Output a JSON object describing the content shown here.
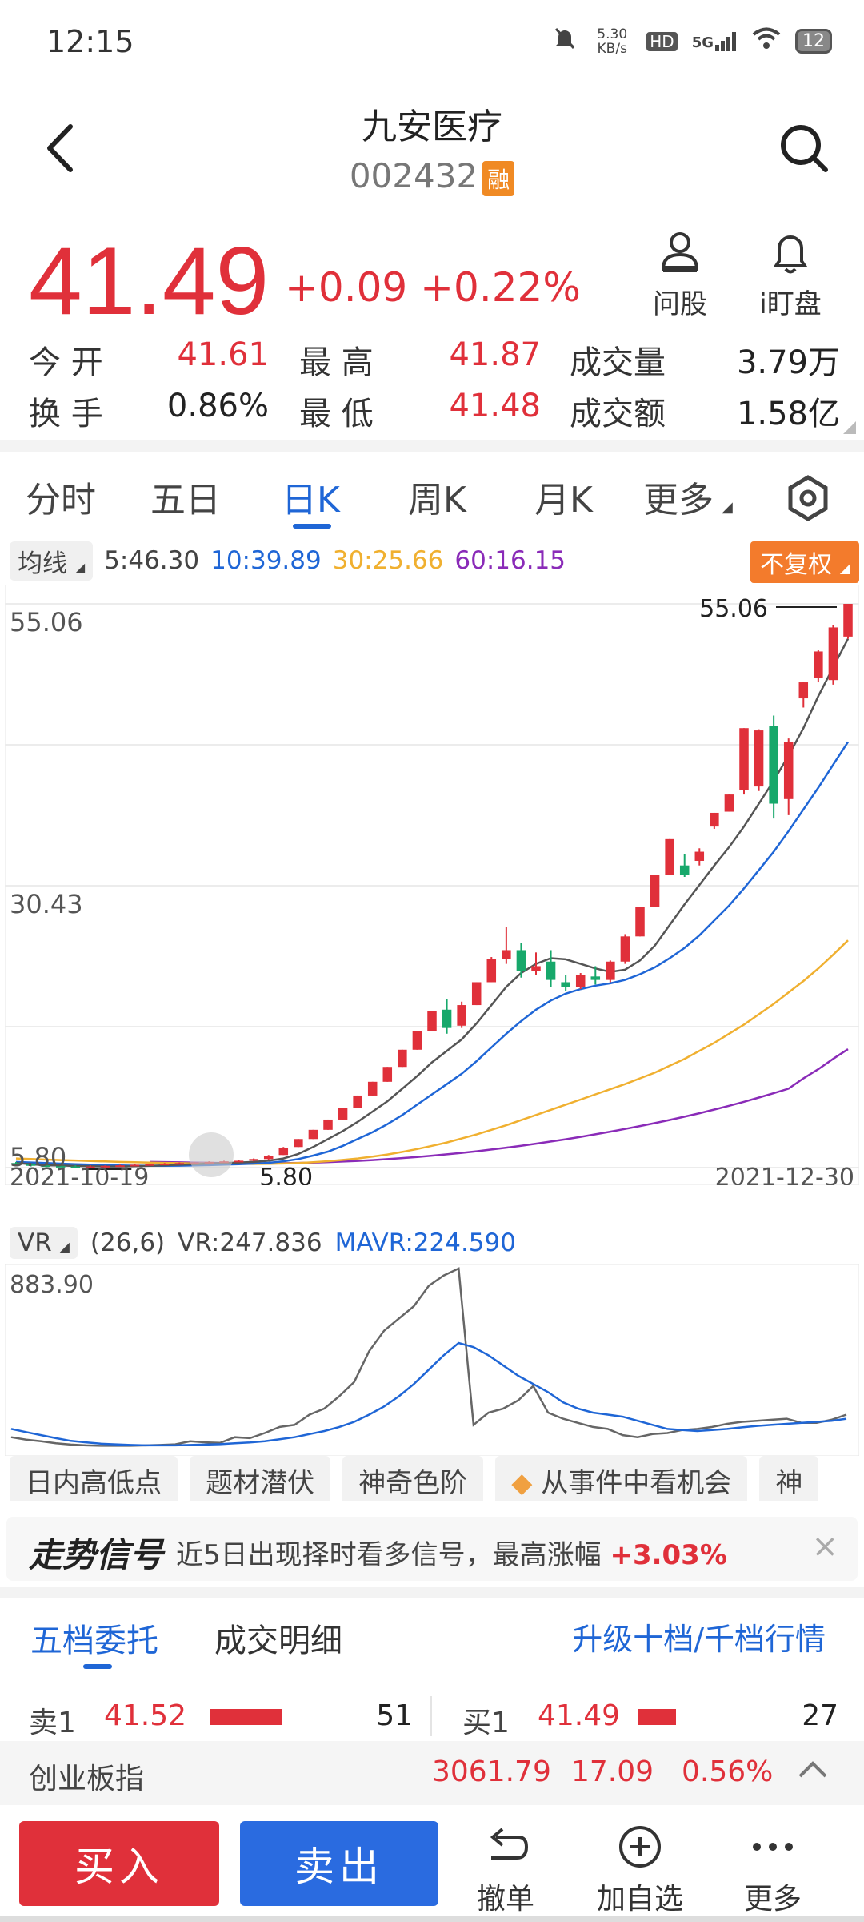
{
  "status": {
    "time": "12:15",
    "net_speed": "5.30 KB/s",
    "hd": "HD",
    "network": "5G",
    "battery": "12"
  },
  "header": {
    "title": "九安医疗",
    "code": "002432",
    "margin_badge": "融"
  },
  "quote": {
    "price": "41.49",
    "change": "+0.09",
    "change_pct": "+0.22%",
    "ask_label": "问股",
    "watch_label": "i盯盘"
  },
  "stats": {
    "open_label": "今 开",
    "open": "41.61",
    "high_label": "最 高",
    "high": "41.87",
    "volume_label": "成交量",
    "volume": "3.79万",
    "turnover_label": "换 手",
    "turnover": "0.86%",
    "low_label": "最 低",
    "low": "41.48",
    "amount_label": "成交额",
    "amount": "1.58亿"
  },
  "tabs": [
    {
      "label": "分时"
    },
    {
      "label": "五日"
    },
    {
      "label": "日K"
    },
    {
      "label": "周K"
    },
    {
      "label": "月K"
    },
    {
      "label": "更多"
    }
  ],
  "ma": {
    "label": "均线",
    "ma5": "5:46.30",
    "ma10": "10:39.89",
    "ma30": "30:25.66",
    "ma60": "60:16.15",
    "adjust": "不复权"
  },
  "colors": {
    "up": "#e0303a",
    "down": "#17a86b",
    "ma5": "#555555",
    "ma10": "#1f66d6",
    "ma30": "#f0b030",
    "ma60": "#8a2bb8"
  },
  "chart_data": [
    {
      "type": "candlestick",
      "title": "",
      "x_start": "2021-10-19",
      "x_end": "2021-12-30",
      "ylim": [
        5.8,
        55.06
      ],
      "y_ticks": [
        "55.06",
        "30.43",
        "5.80"
      ],
      "max_label": "55.06",
      "min_label": "5.80",
      "ohlc": [
        [
          6.2,
          6.3,
          6.0,
          6.1
        ],
        [
          6.1,
          6.2,
          5.9,
          6.0
        ],
        [
          6.0,
          6.1,
          5.9,
          5.95
        ],
        [
          5.95,
          6.05,
          5.85,
          5.9
        ],
        [
          5.9,
          6.0,
          5.8,
          5.85
        ],
        [
          5.85,
          6.0,
          5.8,
          5.9
        ],
        [
          5.9,
          6.0,
          5.85,
          5.95
        ],
        [
          5.95,
          6.05,
          5.9,
          6.0
        ],
        [
          6.0,
          6.1,
          5.95,
          6.05
        ],
        [
          6.05,
          6.15,
          6.0,
          6.1
        ],
        [
          6.1,
          6.2,
          6.05,
          6.15
        ],
        [
          6.15,
          6.25,
          6.1,
          6.2
        ],
        [
          6.2,
          6.3,
          6.15,
          6.25
        ],
        [
          6.25,
          6.35,
          6.2,
          6.3
        ],
        [
          6.3,
          6.4,
          6.25,
          6.35
        ],
        [
          6.35,
          6.45,
          6.3,
          6.4
        ],
        [
          6.4,
          6.6,
          6.35,
          6.55
        ],
        [
          6.55,
          6.9,
          6.5,
          6.85
        ],
        [
          6.9,
          7.6,
          6.9,
          7.55
        ],
        [
          7.6,
          8.3,
          7.6,
          8.3
        ],
        [
          8.3,
          9.1,
          8.3,
          9.1
        ],
        [
          9.1,
          10.0,
          9.1,
          10.0
        ],
        [
          10.0,
          11.0,
          10.0,
          11.0
        ],
        [
          11.0,
          12.1,
          11.0,
          12.1
        ],
        [
          12.1,
          13.3,
          12.1,
          13.3
        ],
        [
          13.3,
          14.6,
          13.3,
          14.6
        ],
        [
          14.6,
          16.1,
          14.6,
          16.1
        ],
        [
          16.1,
          17.7,
          16.1,
          17.7
        ],
        [
          17.7,
          19.5,
          17.7,
          19.5
        ],
        [
          19.6,
          20.5,
          17.5,
          18.0
        ],
        [
          18.2,
          20.3,
          18.0,
          20.0
        ],
        [
          20.0,
          22.0,
          20.0,
          22.0
        ],
        [
          22.0,
          24.2,
          22.0,
          24.0
        ],
        [
          24.0,
          26.8,
          23.6,
          24.8
        ],
        [
          24.8,
          25.4,
          22.4,
          23.0
        ],
        [
          23.0,
          24.6,
          22.6,
          23.4
        ],
        [
          23.8,
          24.8,
          21.6,
          22.2
        ],
        [
          22.0,
          22.6,
          21.2,
          21.6
        ],
        [
          21.6,
          22.8,
          21.4,
          22.6
        ],
        [
          22.5,
          23.4,
          21.8,
          22.2
        ],
        [
          22.2,
          23.9,
          22.0,
          23.8
        ],
        [
          23.8,
          26.2,
          23.6,
          26.0
        ],
        [
          26.0,
          28.6,
          26.0,
          28.6
        ],
        [
          28.6,
          31.4,
          28.6,
          31.4
        ],
        [
          31.4,
          34.5,
          31.4,
          34.5
        ],
        [
          32.2,
          33.2,
          31.2,
          31.4
        ],
        [
          32.6,
          33.7,
          32.2,
          33.4
        ],
        [
          35.6,
          36.8,
          35.4,
          36.8
        ],
        [
          36.9,
          38.4,
          36.9,
          38.4
        ],
        [
          38.8,
          44.2,
          38.4,
          44.2
        ],
        [
          39.1,
          44.1,
          38.7,
          44.0
        ],
        [
          44.4,
          45.3,
          36.3,
          37.6
        ],
        [
          38.0,
          43.3,
          36.6,
          43.0
        ],
        [
          46.8,
          48.2,
          46.0,
          48.2
        ],
        [
          48.6,
          51.0,
          48.2,
          50.9
        ],
        [
          48.4,
          53.2,
          48.0,
          53.0
        ],
        [
          52.2,
          55.06,
          52.0,
          55.06
        ]
      ],
      "ma5": [
        6.2,
        6.1,
        6.0,
        5.98,
        5.94,
        5.92,
        5.9,
        5.9,
        5.92,
        5.96,
        6.0,
        6.05,
        6.1,
        6.15,
        6.2,
        6.25,
        6.3,
        6.4,
        6.6,
        7.0,
        7.6,
        8.3,
        9.0,
        9.8,
        10.7,
        11.6,
        12.7,
        13.8,
        15.0,
        16.0,
        17.0,
        18.4,
        20.0,
        21.6,
        22.8,
        23.6,
        24.1,
        24.0,
        23.6,
        23.2,
        22.9,
        23.1,
        23.9,
        25.2,
        27.0,
        28.8,
        30.5,
        32.2,
        33.8,
        35.6,
        37.6,
        39.6,
        41.8,
        44.2,
        47.0,
        49.5,
        52.0
      ],
      "ma10": [
        6.3,
        6.25,
        6.2,
        6.15,
        6.1,
        6.06,
        6.02,
        5.99,
        5.97,
        5.96,
        5.96,
        5.97,
        5.99,
        6.02,
        6.06,
        6.1,
        6.15,
        6.22,
        6.35,
        6.55,
        6.85,
        7.2,
        7.7,
        8.3,
        8.9,
        9.6,
        10.4,
        11.3,
        12.2,
        13.1,
        14.0,
        15.1,
        16.3,
        17.5,
        18.6,
        19.6,
        20.4,
        21.0,
        21.4,
        21.7,
        21.9,
        22.2,
        22.7,
        23.3,
        24.1,
        25.0,
        26.1,
        27.4,
        28.7,
        30.2,
        31.8,
        33.4,
        35.2,
        37.1,
        39.0,
        41.0,
        43.0
      ],
      "ma30": [
        6.6,
        6.55,
        6.5,
        6.46,
        6.42,
        6.38,
        6.34,
        6.3,
        6.27,
        6.24,
        6.21,
        6.19,
        6.17,
        6.15,
        6.14,
        6.13,
        6.12,
        6.13,
        6.16,
        6.2,
        6.27,
        6.36,
        6.47,
        6.6,
        6.76,
        6.95,
        7.17,
        7.42,
        7.7,
        8.0,
        8.35,
        8.7,
        9.1,
        9.5,
        9.95,
        10.4,
        10.85,
        11.3,
        11.75,
        12.2,
        12.65,
        13.1,
        13.6,
        14.1,
        14.7,
        15.3,
        16.0,
        16.7,
        17.5,
        18.3,
        19.2,
        20.1,
        21.1,
        22.1,
        23.2,
        24.4,
        25.66
      ],
      "ma60": [
        null,
        null,
        null,
        null,
        null,
        null,
        null,
        null,
        null,
        6.3,
        6.28,
        6.26,
        6.24,
        6.22,
        6.2,
        6.19,
        6.18,
        6.18,
        6.19,
        6.21,
        6.24,
        6.28,
        6.33,
        6.39,
        6.46,
        6.54,
        6.63,
        6.73,
        6.84,
        6.96,
        7.09,
        7.23,
        7.38,
        7.54,
        7.71,
        7.89,
        8.08,
        8.28,
        8.49,
        8.71,
        8.94,
        9.18,
        9.43,
        9.69,
        9.96,
        10.25,
        10.55,
        10.87,
        11.2,
        11.55,
        11.92,
        12.3,
        12.7,
        13.6,
        14.4,
        15.3,
        16.15
      ]
    },
    {
      "type": "line",
      "title": "",
      "y_ticks": [
        "883.90"
      ],
      "ylim": [
        0,
        883.9
      ],
      "series": [
        {
          "name": "VR",
          "values": [
            60,
            48,
            40,
            30,
            24,
            20,
            18,
            18,
            18,
            20,
            22,
            25,
            40,
            35,
            32,
            60,
            55,
            80,
            110,
            120,
            170,
            200,
            260,
            330,
            480,
            580,
            640,
            700,
            800,
            850,
            883.9,
            120,
            180,
            200,
            240,
            310,
            180,
            150,
            130,
            110,
            100,
            70,
            60,
            75,
            80,
            95,
            100,
            110,
            125,
            135,
            140,
            145,
            150,
            130,
            130,
            145,
            170
          ]
        },
        {
          "name": "MAVR",
          "values": [
            100,
            85,
            70,
            55,
            42,
            35,
            28,
            25,
            22,
            20,
            20,
            20,
            22,
            24,
            26,
            30,
            34,
            40,
            50,
            60,
            75,
            90,
            110,
            135,
            170,
            210,
            260,
            320,
            390,
            460,
            520,
            500,
            460,
            410,
            360,
            320,
            280,
            230,
            200,
            180,
            170,
            160,
            140,
            120,
            100,
            95,
            90,
            95,
            100,
            108,
            115,
            120,
            125,
            130,
            135,
            140,
            150
          ]
        }
      ]
    }
  ],
  "vr": {
    "label": "VR",
    "params": "(26,6)",
    "vr_value": "VR:247.836",
    "mavr_value": "MAVR:224.590"
  },
  "feature_tags": [
    "日内高低点",
    "题材潜伏",
    "神奇色阶",
    "从事件中看机会",
    "神"
  ],
  "signal": {
    "title": "走势信号",
    "text": "近5日出现择时看多信号，最高涨幅",
    "pct": "+3.03%"
  },
  "orderbook": {
    "tab1": "五档委托",
    "tab2": "成交明细",
    "upgrade": "升级十档/千档行情",
    "sell": {
      "label": "卖1",
      "price": "41.52",
      "qty": "51",
      "fill": 0.7
    },
    "buy": {
      "label": "买1",
      "price": "41.49",
      "qty": "27",
      "fill": 0.36
    }
  },
  "index_bar": {
    "name": "创业板指",
    "value": "3061.79",
    "change": "17.09",
    "pct": "0.56%"
  },
  "bottom": {
    "buy": "买入",
    "sell": "卖出",
    "undo": "撤单",
    "add": "加自选",
    "more": "更多"
  }
}
